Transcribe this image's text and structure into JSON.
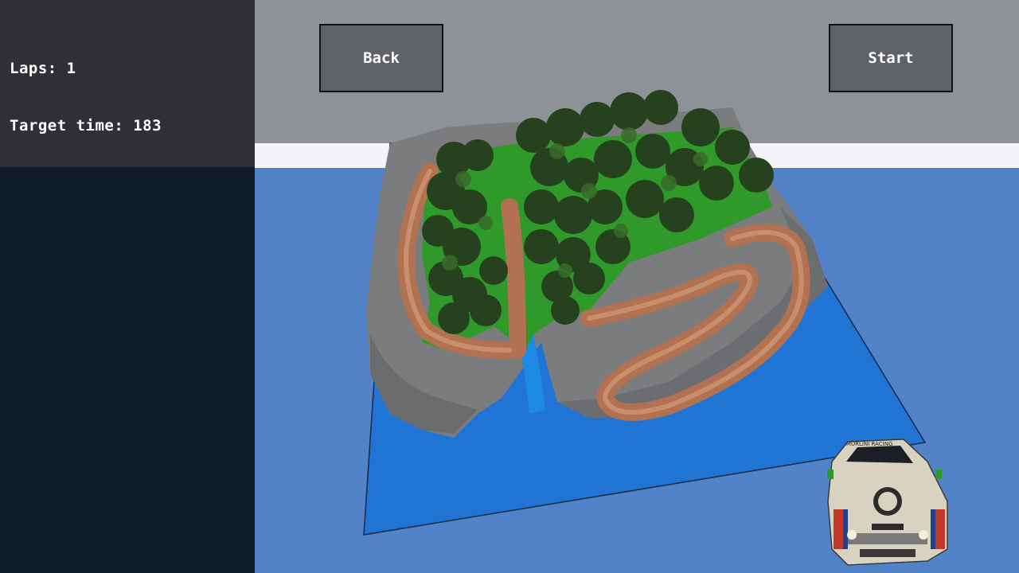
{
  "hud": {
    "laps_label": "Laps: 1",
    "target_time_label": "Target time: 183"
  },
  "buttons": {
    "back_label": "Back",
    "start_label": "Start"
  },
  "car": {
    "decal_text": "MURLINI RACING"
  },
  "colors": {
    "sky": "#8e9196",
    "horizon": "#f2f4f7",
    "water_plane": "#5283c9",
    "river_water": "#1e72d6",
    "grass": "#2f9a2a",
    "dirt_track": "#b27252",
    "rock": "#7a7a7a",
    "ui_button": "#5e6166",
    "info_panel": "#2f3033",
    "side_panel": "#111c2b"
  }
}
